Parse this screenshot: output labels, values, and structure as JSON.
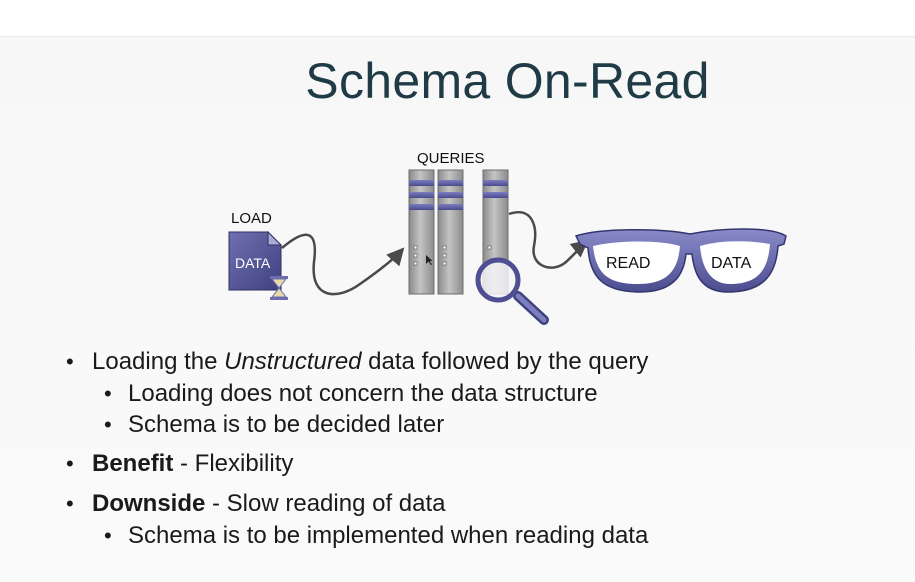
{
  "title": "Schema On-Read",
  "diagram": {
    "load_label": "LOAD",
    "data_file_label": "DATA",
    "queries_label": "QUERIES",
    "glasses_left_label": "READ",
    "glasses_right_label": "DATA"
  },
  "bullets": {
    "b1_pre": "Loading the ",
    "b1_em": "Unstructured",
    "b1_post": " data followed by the query",
    "b1_sub1": "Loading does not concern the data structure",
    "b1_sub2": "Schema is to be decided later",
    "b2_bold": "Benefit",
    "b2_rest": " - Flexibility",
    "b3_bold": "Downside",
    "b3_rest": " - Slow reading of data",
    "b3_sub1": "Schema is to be implemented when reading data"
  },
  "colors": {
    "title": "#1f3b45",
    "accent": "#5a5b9e",
    "server": "#9b9b9b"
  },
  "icons": [
    "data-file-icon",
    "hourglass-icon",
    "server-rack-icon",
    "magnifier-icon",
    "glasses-icon"
  ]
}
